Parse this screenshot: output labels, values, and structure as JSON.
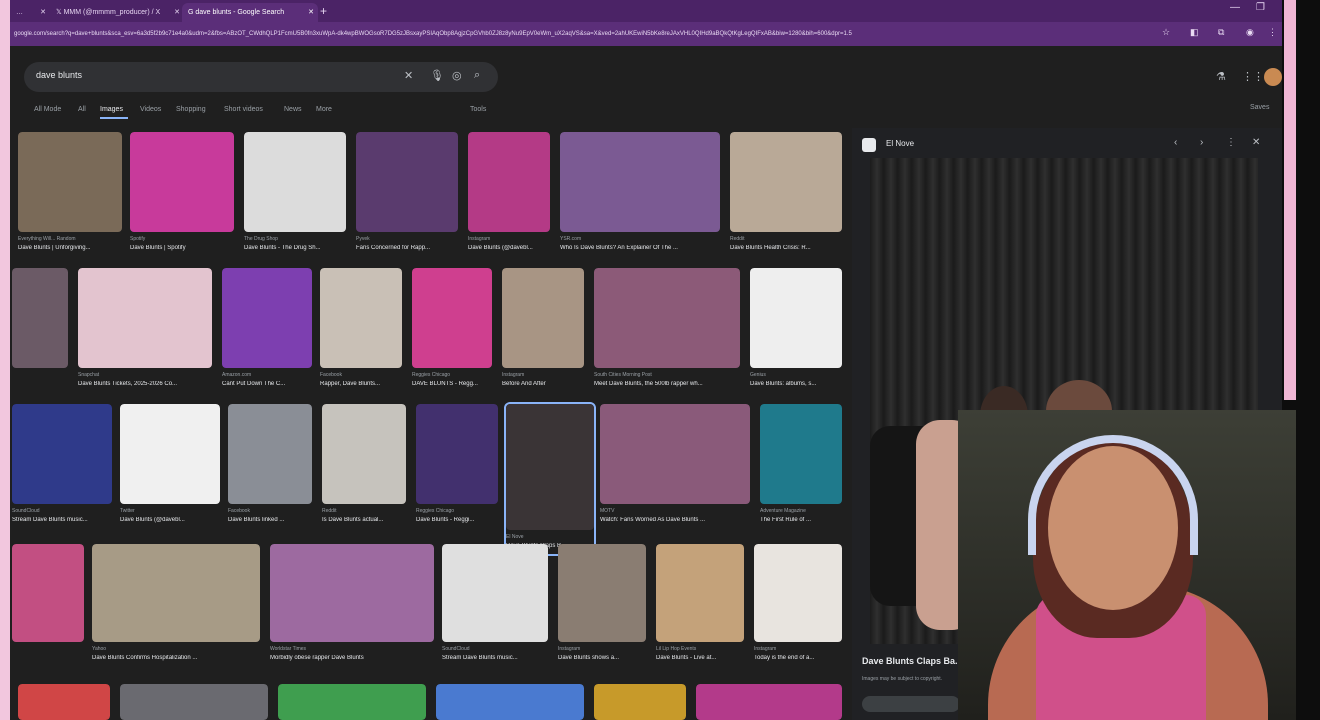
{
  "browser": {
    "tabs": [
      {
        "label": "MMM (@mmmm_producer) / X",
        "active": false
      },
      {
        "label": "dave blunts - Google Search",
        "active": true
      }
    ],
    "new_tab_icon": "plus",
    "url": "google.com/search?q=dave+blunts&sca_esv=6a3d5f2b9c71e4a0&udm=2&fbs=ABzOT_CWdhQLP1FcmU5B0fn3xuWpA-dk4wpBWOGsoR7DG5zJBsxayPSIAqObp8AgjzCpGVhb0ZJ8z8yNu9EpV0eWm_uX2aqVS&sa=X&ved=2ahUKEwiN5bKe8reJAxVHL0QIHd9aBQkQtKgLegQIFxAB&biw=1280&bih=600&dpr=1.5",
    "colors": {
      "tab_bar": "#4b2366",
      "address_bar": "#5b2e79",
      "page_bg": "#1f1f1f"
    }
  },
  "search": {
    "query": "dave blunts",
    "filters": [
      "All Mode",
      "All",
      "Images",
      "Videos",
      "Shopping",
      "Short videos",
      "News",
      "More"
    ],
    "active_filter": "Images",
    "tools_label": "Tools",
    "saves_label": "Saves"
  },
  "results": [
    {
      "source": "Everything Will... Random",
      "caption": "Dave Blunts | Unforgiving...",
      "color": "#7a6a58"
    },
    {
      "source": "Spotify",
      "caption": "Dave Blunts | Spotify",
      "color": "#c83a9b"
    },
    {
      "source": "The Drug Shop",
      "caption": "Dave Blunts - The Drug Sh...",
      "color": "#dcdcdc"
    },
    {
      "source": "Pyvek",
      "caption": "Fans Concerned for Rapp...",
      "color": "#5a3b6e"
    },
    {
      "source": "Instagram",
      "caption": "Dave Blunts (@davebl...",
      "color": "#b43a86"
    },
    {
      "source": "YSR.com",
      "caption": "Who Is Dave Blunts? An Explainer Of The ...",
      "color": "#7b5a93"
    },
    {
      "source": "Reddit",
      "caption": "Dave Blunts Health Crisis: R...",
      "color": "#b9a997"
    },
    {
      "source": "",
      "caption": "",
      "color": "#6b5a66"
    },
    {
      "source": "Snapchat",
      "caption": "Dave Blunts Tickets, 2025-2026 Co...",
      "color": "#e3c4cf"
    },
    {
      "source": "Amazon.com",
      "caption": "Cant Put Down The C...",
      "color": "#7d3fb0"
    },
    {
      "source": "Facebook",
      "caption": "Rapper, Dave Blunts...",
      "color": "#c9c0b6"
    },
    {
      "source": "Reggies Chicago",
      "caption": "DAVE BLUNTS - Regg...",
      "color": "#cf3f8f"
    },
    {
      "source": "Instagram",
      "caption": "Before And After",
      "color": "#a89584"
    },
    {
      "source": "South Cities Morning Post",
      "caption": "Meet Dave Blunts, the 500lb rapper wh...",
      "color": "#8c5a78"
    },
    {
      "source": "Genius",
      "caption": "Dave Blunts: albums, s...",
      "color": "#eeeeee"
    },
    {
      "source": "SoundCloud",
      "caption": "Stream Dave Blunts music...",
      "color": "#2f3a8a"
    },
    {
      "source": "Twitter",
      "caption": "Dave Blunts (@davebl...",
      "color": "#f0f0f0"
    },
    {
      "source": "Facebook",
      "caption": "Dave Blunts linked ...",
      "color": "#8a8e96"
    },
    {
      "source": "Reddit",
      "caption": "Is Dave Blunts actual...",
      "color": "#c6c3bd"
    },
    {
      "source": "Reggies Chicago",
      "caption": "Dave Blunts - Reggi...",
      "color": "#42306e"
    },
    {
      "source": "El Nove",
      "caption": "Dave Blunts Claps B...",
      "color": "#3a3436"
    },
    {
      "source": "MOTV",
      "caption": "Watch: Fans Worried As Dave Blunts ...",
      "color": "#8a5a7a"
    },
    {
      "source": "Adventure Magazine",
      "caption": "The First Rule of ...",
      "color": "#1f7a8c"
    },
    {
      "source": "",
      "caption": "",
      "color": "#c24f82"
    },
    {
      "source": "Yahoo",
      "caption": "Dave Blunts Confirms Hospitalization ...",
      "color": "#a79b86"
    },
    {
      "source": "Worldstar Times",
      "caption": "Morbidly obese rapper Dave Blunts",
      "color": "#9d6aa0"
    },
    {
      "source": "SoundCloud",
      "caption": "Stream Dave Blunts music...",
      "color": "#dfdfdf"
    },
    {
      "source": "Instagram",
      "caption": "Dave Blunts shows a...",
      "color": "#8a7d72"
    },
    {
      "source": "Lil Lip Hop Events",
      "caption": "Dave Blunts - Live at...",
      "color": "#c4a27a"
    },
    {
      "source": "Instagram",
      "caption": "Today is the end of a...",
      "color": "#e8e4df"
    },
    {
      "source": "",
      "caption": "",
      "color": "#d04646"
    },
    {
      "source": "",
      "caption": "",
      "color": "#6a6a70"
    },
    {
      "source": "",
      "caption": "",
      "color": "#3f9e4f"
    },
    {
      "source": "",
      "caption": "",
      "color": "#4a7ad0"
    },
    {
      "source": "",
      "caption": "",
      "color": "#c79a2a"
    },
    {
      "source": "",
      "caption": "",
      "color": "#b33a8a"
    }
  ],
  "panel": {
    "site_name": "El Nove",
    "title": "Dave Blunts Claps Ba...",
    "subtitle": "Images may be subject to copyright."
  }
}
